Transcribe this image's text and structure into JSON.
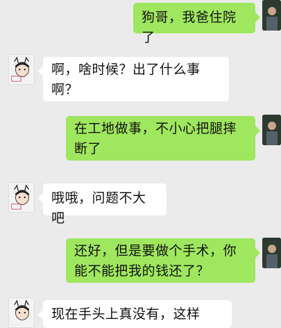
{
  "chat": {
    "messages": [
      {
        "side": "out",
        "text": "狗哥，我爸住院了"
      },
      {
        "side": "in",
        "text": "啊，啥时候？出了什么事啊？"
      },
      {
        "side": "out",
        "text": "在工地做事，不小心把腿摔断了"
      },
      {
        "side": "in",
        "text": "哦哦，问题不大吧"
      },
      {
        "side": "out",
        "text": "还好，但是要做个手术，你能不能把我的钱还了？"
      },
      {
        "side": "in",
        "text": "现在手头上真没有，这样"
      }
    ]
  },
  "colors": {
    "background": "#ebebeb",
    "incoming_bubble": "#ffffff",
    "outgoing_bubble": "#9fe75e"
  },
  "icons": {
    "incoming_avatar": "cartoon-boy-avatar-icon",
    "outgoing_avatar": "person-photo-avatar-icon"
  }
}
